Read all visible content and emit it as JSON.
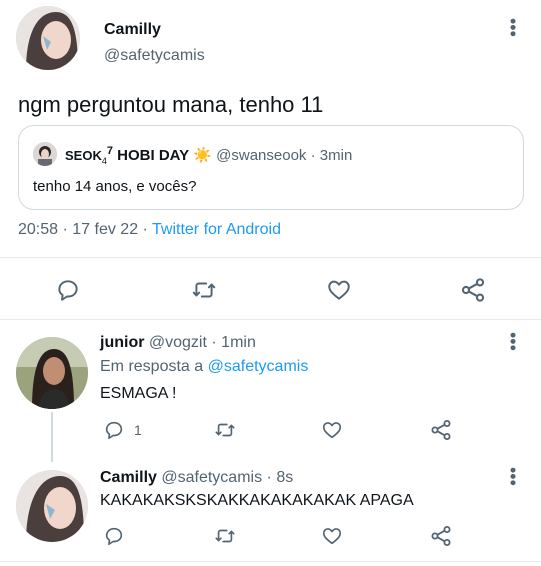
{
  "main_tweet": {
    "display_name": "Camilly",
    "handle": "@safetycamis",
    "text": "ngm perguntou mana, tenho 11",
    "timestamp": "20:58 · 17 fev 22 · ",
    "source": "Twitter for Android"
  },
  "quoted_tweet": {
    "display_name_prefix": "SEOK",
    "display_name_sub": "4",
    "display_name_sup": "7",
    "display_name_main": "HOBI DAY",
    "emoji": "☀️",
    "handle": "@swanseook",
    "time": "· 3min",
    "text": "tenho 14 anos, e vocês?"
  },
  "actions": {
    "reply_icon": "reply-icon",
    "retweet_icon": "retweet-icon",
    "like_icon": "like-icon",
    "share_icon": "share-icon"
  },
  "replies": [
    {
      "display_name": "junior",
      "handle": "@vogzit",
      "time": "· 1min",
      "reply_to_prefix": "Em resposta a ",
      "reply_to_handle": "@safetycamis",
      "text": "ESMAGA !",
      "reply_count": "1"
    },
    {
      "display_name": "Camilly",
      "handle": "@safetycamis",
      "time": "· 8s",
      "text": "KAKAKAKSKSKAKKAKAKAKAKAK APAGA"
    }
  ],
  "colors": {
    "accent": "#1d9bf0",
    "muted": "#536471",
    "border": "#cfd9de"
  }
}
